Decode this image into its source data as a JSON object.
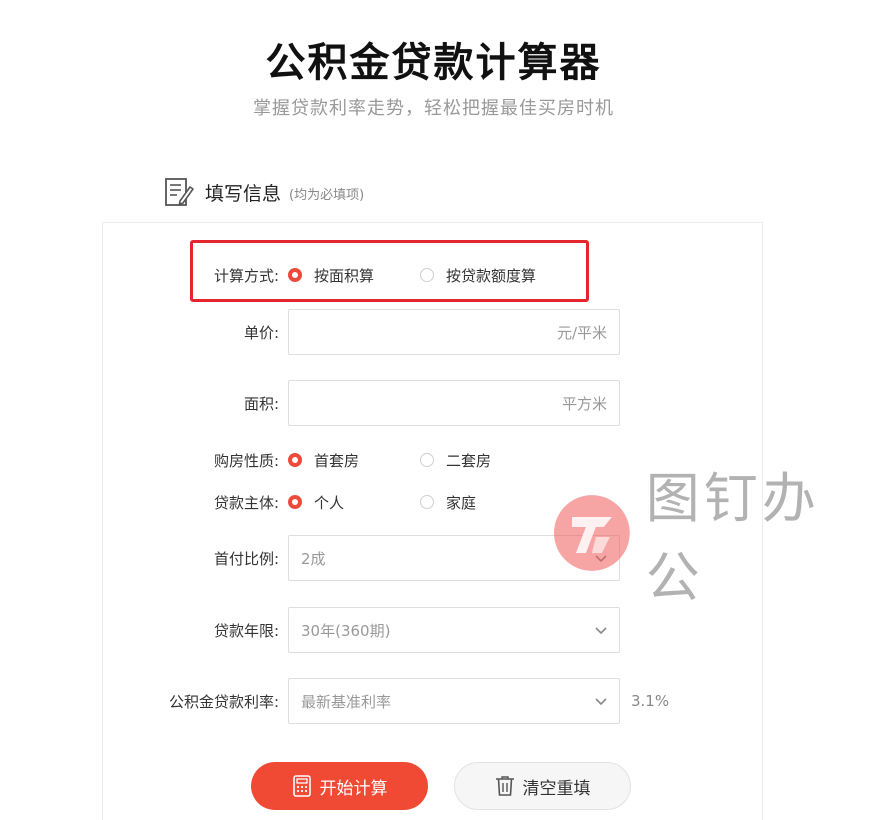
{
  "header": {
    "title": "公积金贷款计算器",
    "subtitle": "掌握贷款利率走势，轻松把握最佳买房时机"
  },
  "section": {
    "title": "填写信息",
    "note": "(均为必填项)",
    "icon": "form-edit-icon"
  },
  "form": {
    "calc_method": {
      "label": "计算方式:",
      "options": [
        "按面积算",
        "按贷款额度算"
      ],
      "selected": "按面积算"
    },
    "unit_price": {
      "label": "单价:",
      "value": "",
      "unit": "元/平米"
    },
    "area": {
      "label": "面积:",
      "value": "",
      "unit": "平方米"
    },
    "property_type": {
      "label": "购房性质:",
      "options": [
        "首套房",
        "二套房"
      ],
      "selected": "首套房"
    },
    "borrower": {
      "label": "贷款主体:",
      "options": [
        "个人",
        "家庭"
      ],
      "selected": "个人"
    },
    "down_payment": {
      "label": "首付比例:",
      "selected": "2成"
    },
    "loan_term": {
      "label": "贷款年限:",
      "selected": "30年(360期)"
    },
    "loan_rate": {
      "label": "公积金贷款利率:",
      "selected": "最新基准利率",
      "value": "3.1%"
    }
  },
  "buttons": {
    "start": "开始计算",
    "clear": "清空重填"
  },
  "watermark": {
    "text": "图钉办公"
  },
  "colors": {
    "accent": "#f04a34",
    "highlight": "#e3262d",
    "muted": "#999999"
  }
}
